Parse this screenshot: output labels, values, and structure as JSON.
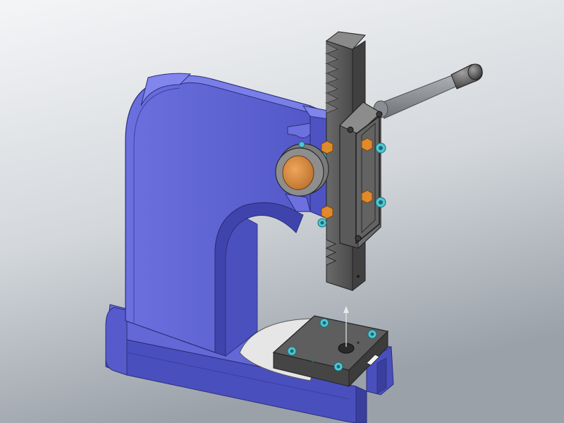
{
  "scene": {
    "subject": "arbor-press-model",
    "colors": {
      "frame_face": "#5a5fd0",
      "frame_light": "#7479e4",
      "frame_dark": "#3c41a6",
      "frame_edge": "#2b2f7a",
      "steel": "#5c5c5c",
      "steel_light": "#8a8a8a",
      "steel_dark": "#3a3a3a",
      "bronze": "#d88a3c",
      "screw": "#4fc7d4",
      "nut": "#e48a2a",
      "background_top": "#f2f3f5",
      "background_bottom": "#9ea5ad"
    },
    "parts": [
      "c-frame",
      "base",
      "rack",
      "pinion-housing",
      "side-cover-plate",
      "pinion-bushing",
      "handle-lever",
      "handle-grip",
      "work-table",
      "table-clearance-disc"
    ]
  }
}
